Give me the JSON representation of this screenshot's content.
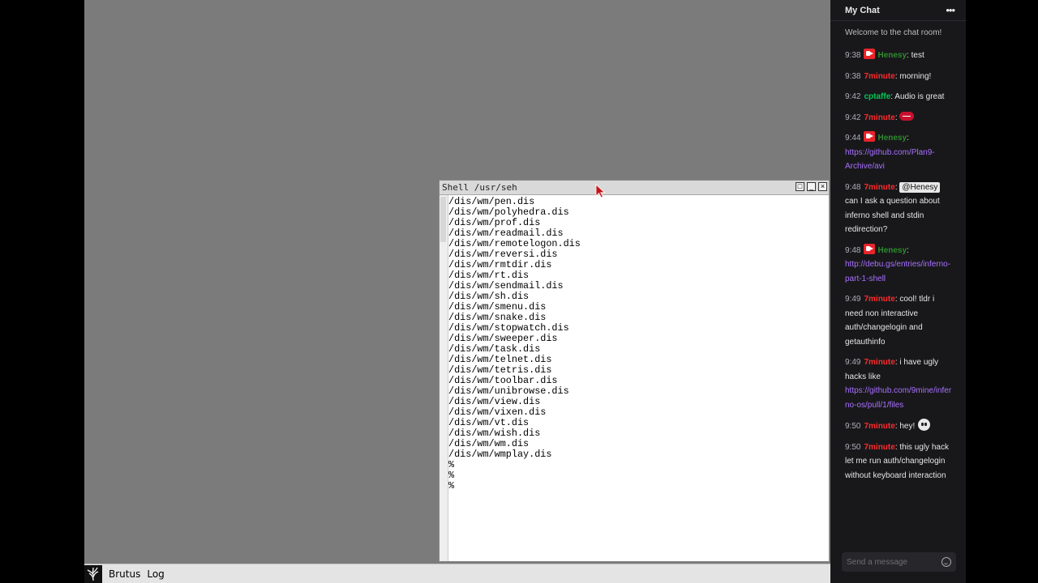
{
  "shell": {
    "title": "Shell /usr/seh",
    "lines": [
      "/dis/wm/pen.dis",
      "/dis/wm/polyhedra.dis",
      "/dis/wm/prof.dis",
      "/dis/wm/readmail.dis",
      "/dis/wm/remotelogon.dis",
      "/dis/wm/reversi.dis",
      "/dis/wm/rmtdir.dis",
      "/dis/wm/rt.dis",
      "/dis/wm/sendmail.dis",
      "/dis/wm/sh.dis",
      "/dis/wm/smenu.dis",
      "/dis/wm/snake.dis",
      "/dis/wm/stopwatch.dis",
      "/dis/wm/sweeper.dis",
      "/dis/wm/task.dis",
      "/dis/wm/telnet.dis",
      "/dis/wm/tetris.dis",
      "/dis/wm/toolbar.dis",
      "/dis/wm/unibrowse.dis",
      "/dis/wm/view.dis",
      "/dis/wm/vixen.dis",
      "/dis/wm/vt.dis",
      "/dis/wm/wish.dis",
      "/dis/wm/wm.dis",
      "/dis/wm/wmplay.dis",
      "%",
      "%",
      "%"
    ]
  },
  "taskbar": {
    "items": [
      "Brutus",
      "Log"
    ]
  },
  "chat": {
    "title": "My Chat",
    "welcome": "Welcome to the chat room!",
    "input_placeholder": "Send a message",
    "colors": {
      "red_user": "#ff2b2b",
      "green_user": "#00c853",
      "link": "#a970ff",
      "background": "#18181b"
    },
    "messages": [
      {
        "time": "9:38",
        "user": "Henesy",
        "badge": "camera-icon",
        "text": "test"
      },
      {
        "time": "9:38",
        "user": "7minute",
        "text": "morning!"
      },
      {
        "time": "9:42",
        "user": "cptaffe",
        "text": "Audio is great"
      },
      {
        "time": "9:42",
        "user": "7minute",
        "text": ""
      },
      {
        "time": "9:44",
        "user": "Henesy",
        "badge": "camera-icon",
        "link": "https://github.com/Plan9-Archive/avi"
      },
      {
        "time": "9:48",
        "user": "7minute",
        "mention": "@Henesy",
        "text": "can I ask a question about inferno shell and stdin redirection?"
      },
      {
        "time": "9:48",
        "user": "Henesy",
        "badge": "camera-icon",
        "link": "http://debu.gs/entries/inferno-part-1-shell"
      },
      {
        "time": "9:49",
        "user": "7minute",
        "text": "cool! tldr i need non interactive auth/changelogin and getauthinfo"
      },
      {
        "time": "9:49",
        "user": "7minute",
        "text": "i have ugly hacks like",
        "link": "https://github.com/9mine/inferno-os/pull/1/files"
      },
      {
        "time": "9:50",
        "user": "7minute",
        "text": "hey!"
      },
      {
        "time": "9:50",
        "user": "7minute",
        "text": "this ugly hack let me run auth/changelogin without keyboard interaction"
      }
    ]
  }
}
